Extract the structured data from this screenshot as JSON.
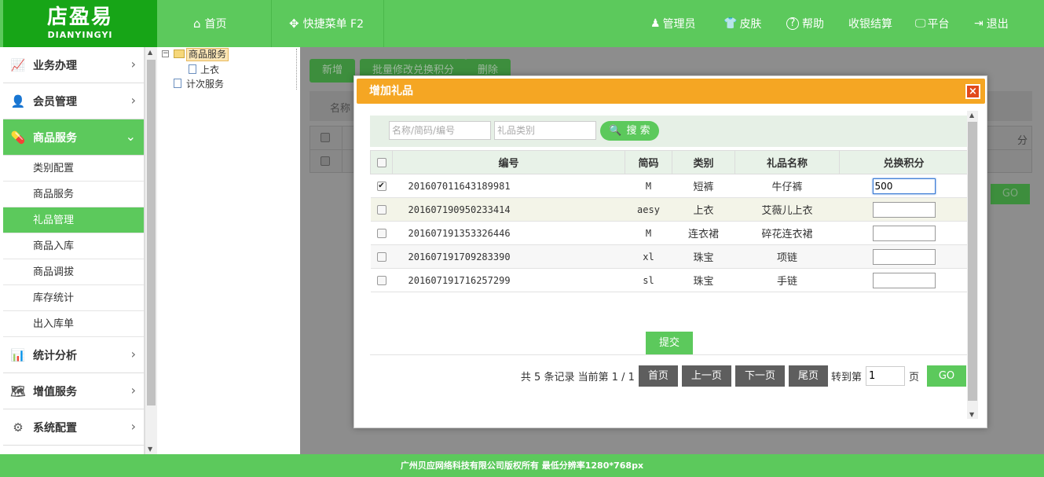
{
  "logo": {
    "cn": "店盈易",
    "en": "DIANYINGYI"
  },
  "topnav": {
    "home": "首页",
    "quickmenu": "快捷菜单 F2"
  },
  "rightnav": {
    "admin": "管理员",
    "skin": "皮肤",
    "help": "帮助",
    "cashier": "收银结算",
    "platform": "平台",
    "logout": "退出"
  },
  "sidebar": {
    "menus": [
      {
        "label": "业务办理",
        "icon": "chart-icon"
      },
      {
        "label": "会员管理",
        "icon": "member-icon"
      },
      {
        "label": "商品服务",
        "icon": "pill-icon"
      },
      {
        "label": "统计分析",
        "icon": "stats-icon"
      },
      {
        "label": "增值服务",
        "icon": "map-icon"
      },
      {
        "label": "系统配置",
        "icon": "gear-icon"
      }
    ],
    "subitems": [
      "类别配置",
      "商品服务",
      "礼品管理",
      "商品入库",
      "商品调拔",
      "库存统计",
      "出入库单"
    ]
  },
  "tree": {
    "root": "商品服务",
    "child": "上衣",
    "sibling": "计次服务"
  },
  "background": {
    "btn_add": "新增",
    "btn_batch": "批量修改兑换积分",
    "btn_delete": "删除",
    "name_label": "名称",
    "right_col": "分",
    "go": "GO"
  },
  "dialog": {
    "title": "增加礼品",
    "search": {
      "name_placeholder": "名称/简码/编号",
      "category_placeholder": "礼品类别",
      "button": "搜 索"
    },
    "columns": [
      "编号",
      "简码",
      "类别",
      "礼品名称",
      "兑换积分"
    ],
    "rows": [
      {
        "code": "201607011643189981",
        "abbr": "M",
        "category": "短裤",
        "name": "牛仔裤",
        "points": "500",
        "checked": true
      },
      {
        "code": "201607190950233414",
        "abbr": "aesy",
        "category": "上衣",
        "name": "艾薇儿上衣",
        "points": "",
        "checked": false
      },
      {
        "code": "201607191353326446",
        "abbr": "M",
        "category": "连衣裙",
        "name": "碎花连衣裙",
        "points": "",
        "checked": false
      },
      {
        "code": "201607191709283390",
        "abbr": "xl",
        "category": "珠宝",
        "name": "项链",
        "points": "",
        "checked": false
      },
      {
        "code": "201607191716257299",
        "abbr": "sl",
        "category": "珠宝",
        "name": "手链",
        "points": "",
        "checked": false
      }
    ],
    "submit": "提交",
    "pager": {
      "summary": "共 5 条记录 当前第 1 / 1",
      "first": "首页",
      "prev": "上一页",
      "next": "下一页",
      "last": "尾页",
      "goto": "转到第",
      "page_value": "1",
      "page_unit": "页",
      "go": "GO"
    }
  },
  "footer": "广州贝应网络科技有限公司版权所有 最低分辨率1280*768px",
  "colors": {
    "brand": "#5cc95c",
    "brand_dark": "#17a517",
    "dialog_title": "#f5a623",
    "close": "#e24a1b"
  }
}
